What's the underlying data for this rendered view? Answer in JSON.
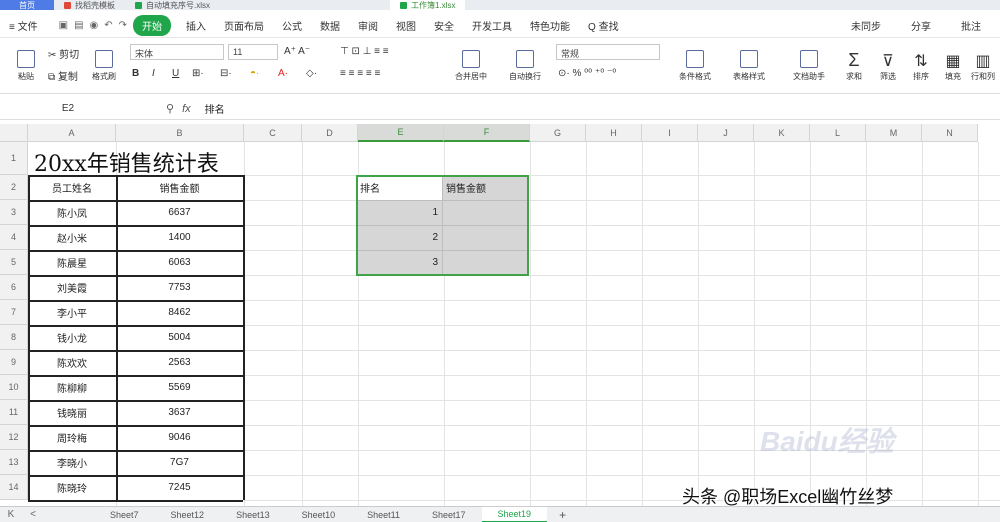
{
  "tabs": [
    {
      "label": "首页"
    },
    {
      "label": "找稻壳模板"
    },
    {
      "label": "自动填充序号.xlsx"
    },
    {
      "label": "工作簿1.xlsx"
    }
  ],
  "menu": {
    "file": "文件",
    "items": [
      "开始",
      "插入",
      "页面布局",
      "公式",
      "数据",
      "审阅",
      "视图",
      "安全",
      "开发工具",
      "特色功能"
    ],
    "search": "Q 查找",
    "right": [
      "未同步",
      "分享",
      "批注"
    ]
  },
  "ribbon": {
    "cut": "剪切",
    "copy": "复制",
    "paste": "粘贴",
    "format_painter": "格式刷",
    "font_name": "宋体",
    "font_size": "11",
    "merge": "合并居中",
    "wrap": "自动换行",
    "number_format": "常规",
    "cond_format": "条件格式",
    "table_style": "表格样式",
    "doc_assistant": "文档助手",
    "sum": "求和",
    "filter": "筛选",
    "sort": "排序",
    "fill": "填充",
    "row_col": "行和列"
  },
  "formula_bar": {
    "cell_ref": "E2",
    "fx": "fx",
    "value": "排名"
  },
  "columns": [
    "A",
    "B",
    "C",
    "D",
    "E",
    "F",
    "G",
    "H",
    "I",
    "J",
    "K",
    "L",
    "M",
    "N"
  ],
  "rows": [
    "1",
    "2",
    "3",
    "4",
    "5",
    "6",
    "7",
    "8",
    "9",
    "10",
    "11",
    "12",
    "13",
    "14"
  ],
  "sheet_title": "20xx年销售统计表",
  "table": {
    "headers": [
      "员工姓名",
      "销售金额"
    ],
    "rows": [
      [
        "陈小凤",
        "6637"
      ],
      [
        "赵小米",
        "1400"
      ],
      [
        "陈晨星",
        "6063"
      ],
      [
        "刘美霞",
        "7753"
      ],
      [
        "李小平",
        "8462"
      ],
      [
        "钱小龙",
        "5004"
      ],
      [
        "陈欢欢",
        "2563"
      ],
      [
        "陈柳柳",
        "5569"
      ],
      [
        "钱晓丽",
        "3637"
      ],
      [
        "周玲梅",
        "9046"
      ],
      [
        "李晓小",
        "7G7"
      ],
      [
        "陈晓玲",
        "7245"
      ]
    ]
  },
  "rank_table": {
    "headers": [
      "排名",
      "销售金额"
    ],
    "ranks": [
      "1",
      "2",
      "3"
    ]
  },
  "sheets": [
    "Sheet7",
    "Sheet12",
    "Sheet13",
    "Sheet10",
    "Sheet11",
    "Sheet17",
    "Sheet19"
  ],
  "sheet_nav": {
    "first": "K",
    "prev": "<",
    "add": "+"
  },
  "watermark": "Baidu经验",
  "credit": "头条 @职场Excel幽竹丝梦"
}
